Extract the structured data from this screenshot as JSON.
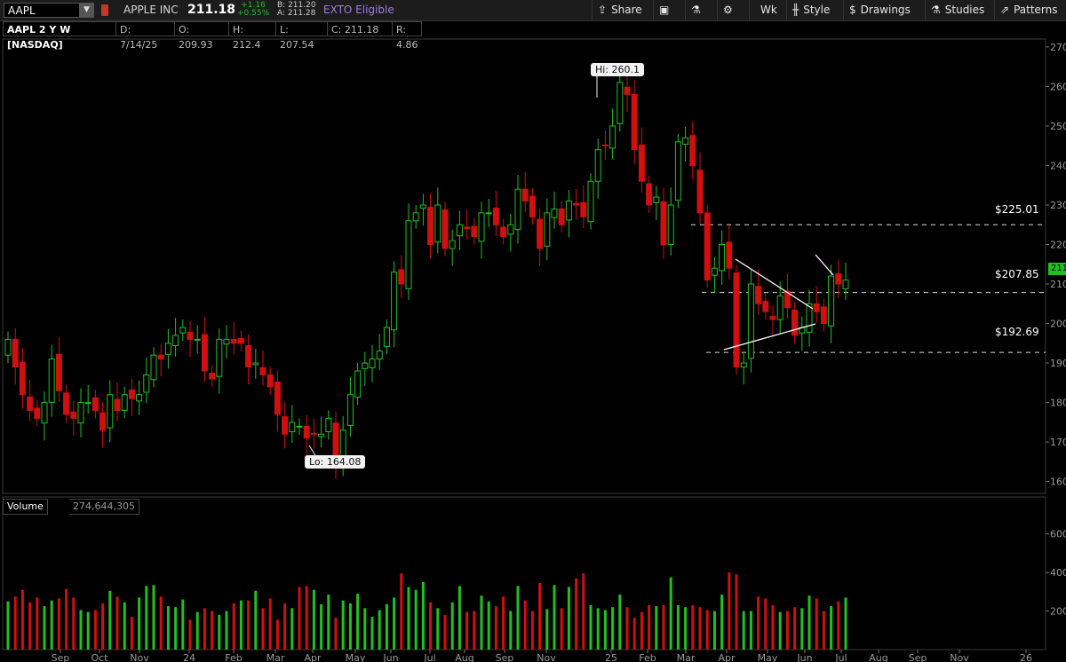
{
  "header": {
    "symbol": "AAPL",
    "company": "APPLE INC",
    "last": "211.18",
    "change": "+1.16",
    "change_pct": "+0.55%",
    "bid": "B: 211.20",
    "ask": "A: 211.28",
    "exto": "EXTO Eligible"
  },
  "toolbar": {
    "share": "Share",
    "aggregation": "Wk",
    "style": "Style",
    "drawings": "Drawings",
    "studies": "Studies",
    "patterns": "Patterns"
  },
  "info": {
    "title": "AAPL 2 Y W [NASDAQ]",
    "date": "D: 7/14/25",
    "open": "O: 209.93",
    "high": "H: 212.4",
    "low": "L: 207.54",
    "close": "C: 211.18",
    "range": "R: 4.86"
  },
  "annotations": {
    "hi": "Hi: 260.1",
    "lo": "Lo: 164.08",
    "levels": [
      "$225.01",
      "$207.85",
      "$192.69"
    ],
    "last_tag": "211"
  },
  "volume": {
    "label": "Volume",
    "value": "274,644,305"
  },
  "colors": {
    "up": "#21c021",
    "down": "#d01010",
    "background": "#000000",
    "accent": "#9e7de8"
  },
  "chart_data": {
    "type": "candlestick",
    "price_axis": [
      "270",
      "260",
      "250",
      "240",
      "230",
      "220",
      "210",
      "200",
      "190",
      "180",
      "170",
      "160"
    ],
    "volume_axis": [
      "600",
      "400",
      "200"
    ],
    "x_labels": [
      "Sep",
      "Oct",
      "Nov",
      "24",
      "Feb",
      "Mar",
      "Apr",
      "May",
      "Jun",
      "Jul",
      "Aug",
      "Sep",
      "Nov",
      "25",
      "Feb",
      "Mar",
      "Apr",
      "May",
      "Jun",
      "Jul",
      "Aug",
      "Sep",
      "Nov",
      "26"
    ],
    "ylim": [
      157,
      272
    ],
    "vol_ylim": [
      0,
      700
    ],
    "levels": [
      225.01,
      207.85,
      192.69
    ],
    "hi": 260.1,
    "lo": 164.08,
    "closes": [
      196,
      189,
      182,
      178,
      176,
      180,
      191,
      183,
      177,
      176,
      180,
      180,
      178,
      173,
      182,
      178,
      182,
      181,
      182,
      187,
      192,
      191,
      195,
      197,
      199,
      196,
      196,
      188,
      186,
      196,
      196,
      195,
      195,
      189,
      190,
      187,
      184,
      177,
      172,
      175,
      174,
      171,
      172,
      172,
      176,
      165,
      173,
      182,
      188,
      190,
      191,
      193,
      199,
      213,
      210,
      226,
      228,
      230,
      220,
      230,
      219,
      221,
      225,
      224,
      222,
      228,
      228,
      225,
      222,
      225,
      234,
      231,
      227,
      219,
      228,
      229,
      225,
      231,
      230,
      227,
      236,
      244,
      245,
      250,
      261,
      258,
      244,
      236,
      230,
      232,
      220,
      230,
      246,
      247,
      240,
      228,
      211,
      214,
      220,
      214,
      189,
      190,
      210,
      205,
      203,
      201,
      207,
      204,
      197,
      199,
      205,
      203,
      200,
      212,
      210,
      211
    ],
    "volumes": [
      250,
      275,
      310,
      245,
      270,
      225,
      255,
      265,
      315,
      270,
      205,
      195,
      205,
      240,
      305,
      275,
      245,
      170,
      270,
      330,
      335,
      275,
      225,
      220,
      260,
      155,
      195,
      215,
      200,
      180,
      200,
      240,
      255,
      255,
      305,
      215,
      265,
      155,
      240,
      215,
      325,
      330,
      310,
      235,
      285,
      165,
      255,
      240,
      290,
      215,
      170,
      205,
      235,
      270,
      395,
      325,
      310,
      350,
      245,
      215,
      180,
      245,
      330,
      195,
      200,
      280,
      250,
      225,
      275,
      200,
      330,
      255,
      200,
      345,
      210,
      335,
      215,
      325,
      370,
      395,
      230,
      215,
      205,
      220,
      285,
      220,
      165,
      195,
      230,
      225,
      230,
      375,
      230,
      220,
      230,
      220,
      205,
      200,
      285,
      400,
      390,
      200,
      200,
      275,
      265,
      230,
      195,
      200,
      220,
      215,
      280,
      265,
      200,
      225,
      250,
      270
    ]
  }
}
